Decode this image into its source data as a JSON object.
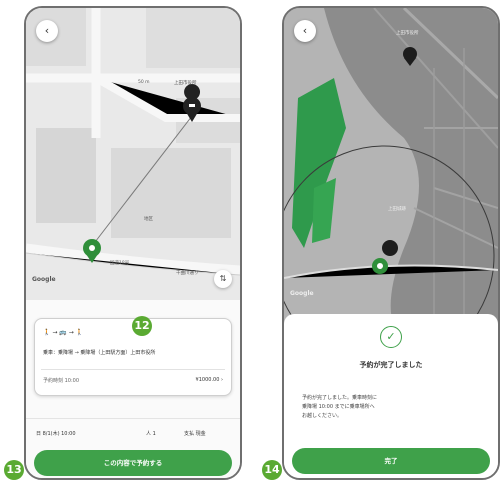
{
  "badges": {
    "b12": "12",
    "b13": "13",
    "b14": "14"
  },
  "screen1": {
    "back_glyph": "‹",
    "map": {
      "dest_label": "上田市役所",
      "mid_label": "50 m",
      "area_label": "地区",
      "road_label_1": "国道18号",
      "road_label_2": "千曲川通り",
      "map_brand": "Google",
      "route_toggle_glyph": "⇅"
    },
    "card": {
      "route_line": "→ 🚌 → 🚶",
      "detail_line": "乗車：乗降場 → 乗降場（上田駅方面）上田市役所",
      "time_label": "予約時刻 10:00",
      "fare": "¥1000.00",
      "fare_arrow": "›"
    },
    "options": {
      "date": "日 8/1(木) 10:00",
      "people": "人 1",
      "payment": "支払 現金"
    },
    "confirm_button": "この内容で予約する"
  },
  "screen2": {
    "back_glyph": "‹",
    "map": {
      "top_label": "上田市役所",
      "place_label": "上田城跡",
      "map_brand": "Google"
    },
    "sheet": {
      "check_glyph": "✓",
      "title": "予約が完了しました",
      "message_line1": "予約が完了しました。乗車時刻に",
      "message_line2": "乗降場 10:00 までに乗車場所へ",
      "message_line3": "お越しください。"
    },
    "done_button": "完了"
  }
}
